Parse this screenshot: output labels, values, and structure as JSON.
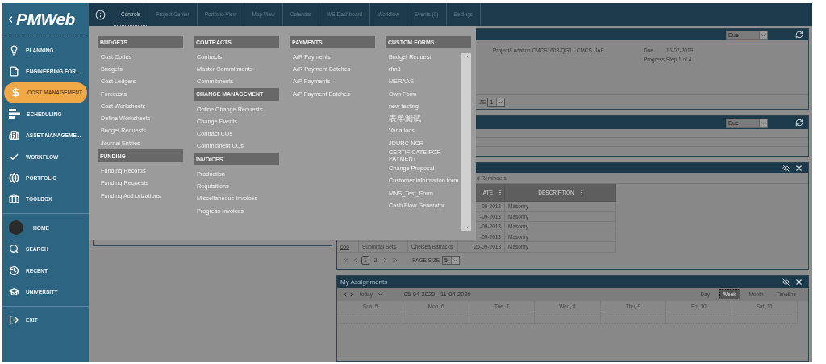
{
  "sidebar": {
    "logo": "PMWeb",
    "modules": [
      {
        "label": "PLANNING",
        "selected": false
      },
      {
        "label": "ENGINEERING FOR...",
        "selected": false
      },
      {
        "label": "COST MANAGEMENT",
        "selected": true
      },
      {
        "label": "SCHEDULING",
        "selected": false
      },
      {
        "label": "ASSET MANAGEME...",
        "selected": false
      },
      {
        "label": "WORKFLOW",
        "selected": false
      },
      {
        "label": "PORTFOLIO",
        "selected": false
      },
      {
        "label": "TOOLBOX",
        "selected": false
      }
    ],
    "links": [
      {
        "label": "HOME"
      },
      {
        "label": "SEARCH"
      },
      {
        "label": "RECENT"
      },
      {
        "label": "UNIVERSITY"
      }
    ],
    "exit": "EXIT"
  },
  "tabs": [
    {
      "label": "Controls",
      "selected": true
    },
    {
      "label": "Project Center",
      "selected": false
    },
    {
      "label": "Portfolio View",
      "selected": false
    },
    {
      "label": "Map View",
      "selected": false
    },
    {
      "label": "Calendar",
      "selected": false
    },
    {
      "label": "WS Dashboard",
      "selected": false
    },
    {
      "label": "Workflow",
      "selected": false
    },
    {
      "label": "Events (0)",
      "selected": false
    },
    {
      "label": "Settings",
      "selected": false
    }
  ],
  "menu": {
    "columns": [
      {
        "sections": [
          {
            "title": "BUDGETS",
            "items": [
              "Cost Codes",
              "Budgets",
              "Cost Ledgers",
              "Forecasts",
              "Cost Worksheets",
              "Define Worksheets",
              "Budget Requests",
              "Journal Entries"
            ]
          },
          {
            "title": "FUNDING",
            "items": [
              "Funding Records",
              "Funding Requests",
              "Funding Authorizations"
            ]
          }
        ]
      },
      {
        "sections": [
          {
            "title": "CONTRACTS",
            "items": [
              "Contracts",
              "Master Commitments",
              "Commitments"
            ]
          },
          {
            "title": "CHANGE MANAGEMENT",
            "items": [
              "Online Change Requests",
              "Change Events",
              "Contract COs",
              "Commitment COs"
            ]
          },
          {
            "title": "INVOICES",
            "items": [
              "Production",
              "Requisitions",
              "Miscellaneous Invoices",
              "Progress Invoices"
            ]
          }
        ]
      },
      {
        "sections": [
          {
            "title": "PAYMENTS",
            "items": [
              "A/R Payments",
              "A/R Payment Batches",
              "A/P Payments",
              "A/P Payment Batches"
            ]
          }
        ]
      },
      {
        "scrollable": true,
        "sections": [
          {
            "title": "CUSTOM FORMS",
            "items": [
              "Budget Request",
              "rfm3",
              "MERAAS",
              "Own Form",
              "new testing",
              "表单测试",
              "Variations",
              "JDURC-NCR",
              "CERTIFICATE FOR PAYMENT",
              "Change Proposal",
              "Customer information form",
              "MNS_Test_Form",
              "Cash Flow Generator"
            ]
          }
        ]
      }
    ]
  },
  "due_panel": {
    "filter": "Due",
    "project": "Project/Location CMCS1603-QG1 - CMCS UAE",
    "due_label": "Due",
    "due_date": "16-07-2019",
    "progress": "Progress Step 1 of 4",
    "page_size_label": "ZE",
    "page_size": "1"
  },
  "due_panel_2": {
    "filter": "Due"
  },
  "reminders_panel": {
    "subtitle": "d Reminders",
    "columns": [
      "ATE",
      "DESCRIPTION"
    ],
    "rows": [
      {
        "date": "-09-2013",
        "description": "Masonry"
      },
      {
        "date": "-09-2013",
        "description": "Masonry"
      },
      {
        "date": "-09-2013",
        "description": "Masonry"
      },
      {
        "date": "-09-2013",
        "description": "Masonry"
      },
      {
        "id": "ooo",
        "type": "Submittal Sets",
        "project": "Chelsea Barracks",
        "date": "25-09-2013",
        "description": "Masonry"
      }
    ],
    "pages": [
      {
        "label": "1",
        "selected": true
      },
      {
        "label": "2",
        "selected": false
      }
    ],
    "page_size_label": "PAGE SIZE",
    "page_size": "5"
  },
  "assignments": {
    "title": "My Assignments",
    "today": "today",
    "range": "05-04-2020 - 11-04-2020",
    "views": [
      {
        "label": "Day",
        "selected": false
      },
      {
        "label": "Week",
        "selected": true
      },
      {
        "label": "Month",
        "selected": false
      },
      {
        "label": "Timeline",
        "selected": false
      }
    ],
    "days": [
      "Sun, 5",
      "Mon, 6",
      "Tue, 7",
      "Wed, 8",
      "Thu, 9",
      "Fri, 10",
      "Sat, 11"
    ]
  }
}
